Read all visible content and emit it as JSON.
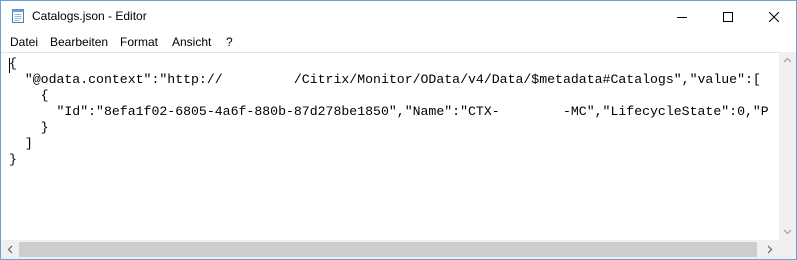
{
  "window": {
    "title": "Catalogs.json - Editor",
    "icons": {
      "app": "notepad-icon",
      "minimize": "minimize-icon",
      "maximize": "maximize-icon",
      "close": "close-icon"
    }
  },
  "menu": {
    "items": [
      "Datei",
      "Bearbeiten",
      "Format",
      "Ansicht",
      "?"
    ]
  },
  "editor": {
    "lines": [
      "{",
      "  \"@odata.context\":\"http://         /Citrix/Monitor/OData/v4/Data/$metadata#Catalogs\",\"value\":[",
      "    {",
      "      \"Id\":\"8efa1f02-6805-4a6f-880b-87d278be1850\",\"Name\":\"CTX-        -MC\",\"LifecycleState\":0,\"P",
      "    }",
      "  ]",
      "}"
    ]
  },
  "scrollbars": {
    "horizontal_thumb_fraction": 0.97
  },
  "colors": {
    "window_border": "#6f9fd8",
    "scrollbar_track": "#f0f0f0",
    "scrollbar_thumb": "#cdcdcd"
  }
}
